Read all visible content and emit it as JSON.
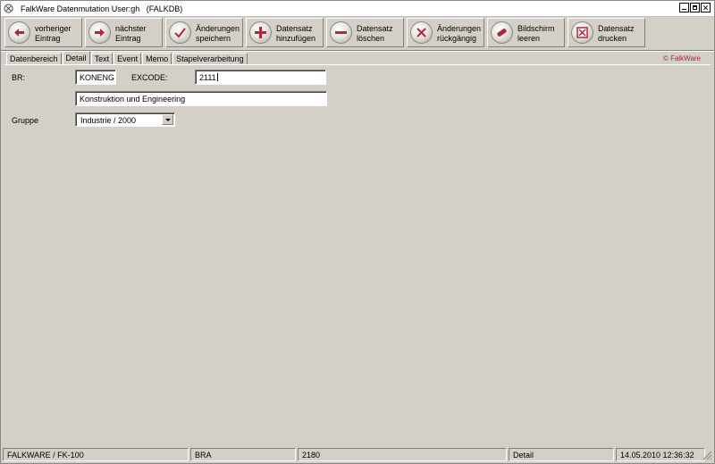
{
  "window": {
    "title": "FalkWare Datenmutation User:gh   (FALKDB)"
  },
  "toolbar": {
    "buttons": [
      {
        "label": "vorheriger\nEintrag",
        "icon": "arrow-left-icon"
      },
      {
        "label": "nächster\nEintrag",
        "icon": "arrow-right-icon"
      },
      {
        "label": "Änderungen\nspeichern",
        "icon": "checkmark-icon"
      },
      {
        "label": "Datensatz\nhinzufügen",
        "icon": "plus-icon"
      },
      {
        "label": "Datensatz\nlöschen",
        "icon": "minus-icon"
      },
      {
        "label": "Änderungen\nrückgängig",
        "icon": "x-icon"
      },
      {
        "label": "Bildschirm\nleeren",
        "icon": "eraser-icon"
      },
      {
        "label": "Datensatz\ndrucken",
        "icon": "print-icon"
      }
    ]
  },
  "tabs": [
    "Datenbereich",
    "Detail",
    "Text",
    "Event",
    "Memo",
    "Stapelverarbeitung"
  ],
  "active_tab": "Detail",
  "brand": "© FalkWare",
  "form": {
    "br_label": "BR:",
    "br_value": "KONENG",
    "excode_label": "EXCODE:",
    "excode_value": "2111",
    "description_value": "Konstruktion und Engineering",
    "gruppe_label": "Gruppe",
    "gruppe_value": "Industrie / 2000"
  },
  "statusbar": {
    "cells": [
      "FALKWARE / FK-100",
      "BRA",
      "2180",
      "Detail",
      "14.05.2010 12:36:32"
    ]
  },
  "colors": {
    "accent": "#b0283b",
    "face": "#d4d0c8"
  }
}
